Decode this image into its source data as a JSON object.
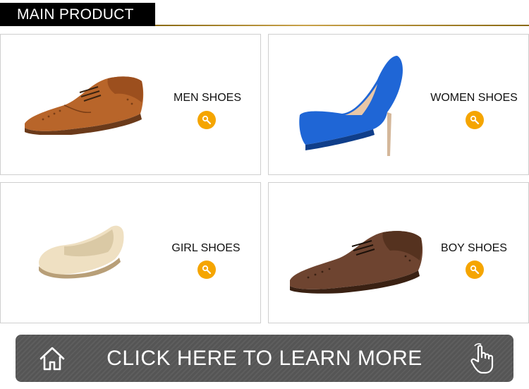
{
  "header": {
    "title": "MAIN PRODUCT"
  },
  "products": [
    {
      "label": "MEN SHOES"
    },
    {
      "label": "WOMEN SHOES"
    },
    {
      "label": "GIRL SHOES"
    },
    {
      "label": "BOY SHOES"
    }
  ],
  "banner": {
    "text": "CLICK HERE TO LEARN MORE"
  },
  "icons": {
    "search": "search-icon",
    "home": "home-icon",
    "hand": "hand-pointer-icon"
  },
  "colors": {
    "accent": "#f5a500",
    "header_bg": "#000000",
    "gold_line": "#c9a24a",
    "banner_bg": "#555555",
    "card_border": "#cfcfcf"
  }
}
